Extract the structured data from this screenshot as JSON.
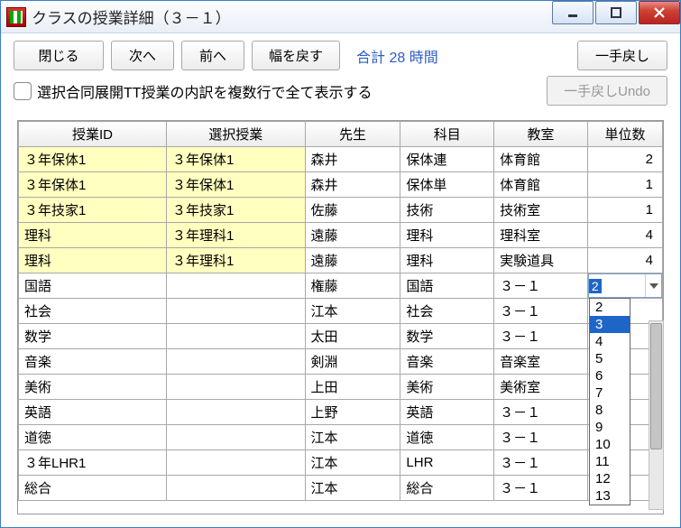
{
  "window": {
    "title": "クラスの授業詳細（３－１）"
  },
  "toolbar": {
    "close": "閉じる",
    "next": "次へ",
    "prev": "前へ",
    "reset_width": "幅を戻す",
    "undo": "一手戻し",
    "undo_disabled": "一手戻しUndo",
    "total": "合計 28 時間"
  },
  "checkbox": {
    "label": "選択合同展開TT授業の内訳を複数行で全て表示する"
  },
  "columns": [
    "授業ID",
    "選択授業",
    "先生",
    "科目",
    "教室",
    "単位数"
  ],
  "rows": [
    {
      "id": "３年保体1",
      "sel": "３年保体1",
      "teacher": "森井",
      "subject": "保体連",
      "room": "体育館",
      "units": "2",
      "hl": true
    },
    {
      "id": "３年保体1",
      "sel": "３年保体1",
      "teacher": "森井",
      "subject": "保体単",
      "room": "体育館",
      "units": "1",
      "hl": true
    },
    {
      "id": "３年技家1",
      "sel": "３年技家1",
      "teacher": "佐藤",
      "subject": "技術",
      "room": "技術室",
      "units": "1",
      "hl": true
    },
    {
      "id": "理科",
      "sel": "３年理科1",
      "teacher": "遠藤",
      "subject": "理科",
      "room": "理科室",
      "units": "4",
      "hl": true
    },
    {
      "id": "理科",
      "sel": "３年理科1",
      "teacher": "遠藤",
      "subject": "理科",
      "room": "実験道具",
      "units": "4",
      "hl": true
    },
    {
      "id": "国語",
      "sel": "",
      "teacher": "権藤",
      "subject": "国語",
      "room": "３－１",
      "units": "2",
      "editing": true
    },
    {
      "id": "社会",
      "sel": "",
      "teacher": "江本",
      "subject": "社会",
      "room": "３－１",
      "units": ""
    },
    {
      "id": "数学",
      "sel": "",
      "teacher": "太田",
      "subject": "数学",
      "room": "３－１",
      "units": ""
    },
    {
      "id": "音楽",
      "sel": "",
      "teacher": "剣淵",
      "subject": "音楽",
      "room": "音楽室",
      "units": ""
    },
    {
      "id": "美術",
      "sel": "",
      "teacher": "上田",
      "subject": "美術",
      "room": "美術室",
      "units": ""
    },
    {
      "id": "英語",
      "sel": "",
      "teacher": "上野",
      "subject": "英語",
      "room": "３－１",
      "units": ""
    },
    {
      "id": "道徳",
      "sel": "",
      "teacher": "江本",
      "subject": "道徳",
      "room": "３－１",
      "units": ""
    },
    {
      "id": "３年LHR1",
      "sel": "",
      "teacher": "江本",
      "subject": "LHR",
      "room": "３－１",
      "units": ""
    },
    {
      "id": "総合",
      "sel": "",
      "teacher": "江本",
      "subject": "総合",
      "room": "３－１",
      "units": ""
    }
  ],
  "dropdown": {
    "selected": "3",
    "options": [
      "2",
      "3",
      "4",
      "5",
      "6",
      "7",
      "8",
      "9",
      "10",
      "11",
      "12",
      "13"
    ]
  }
}
